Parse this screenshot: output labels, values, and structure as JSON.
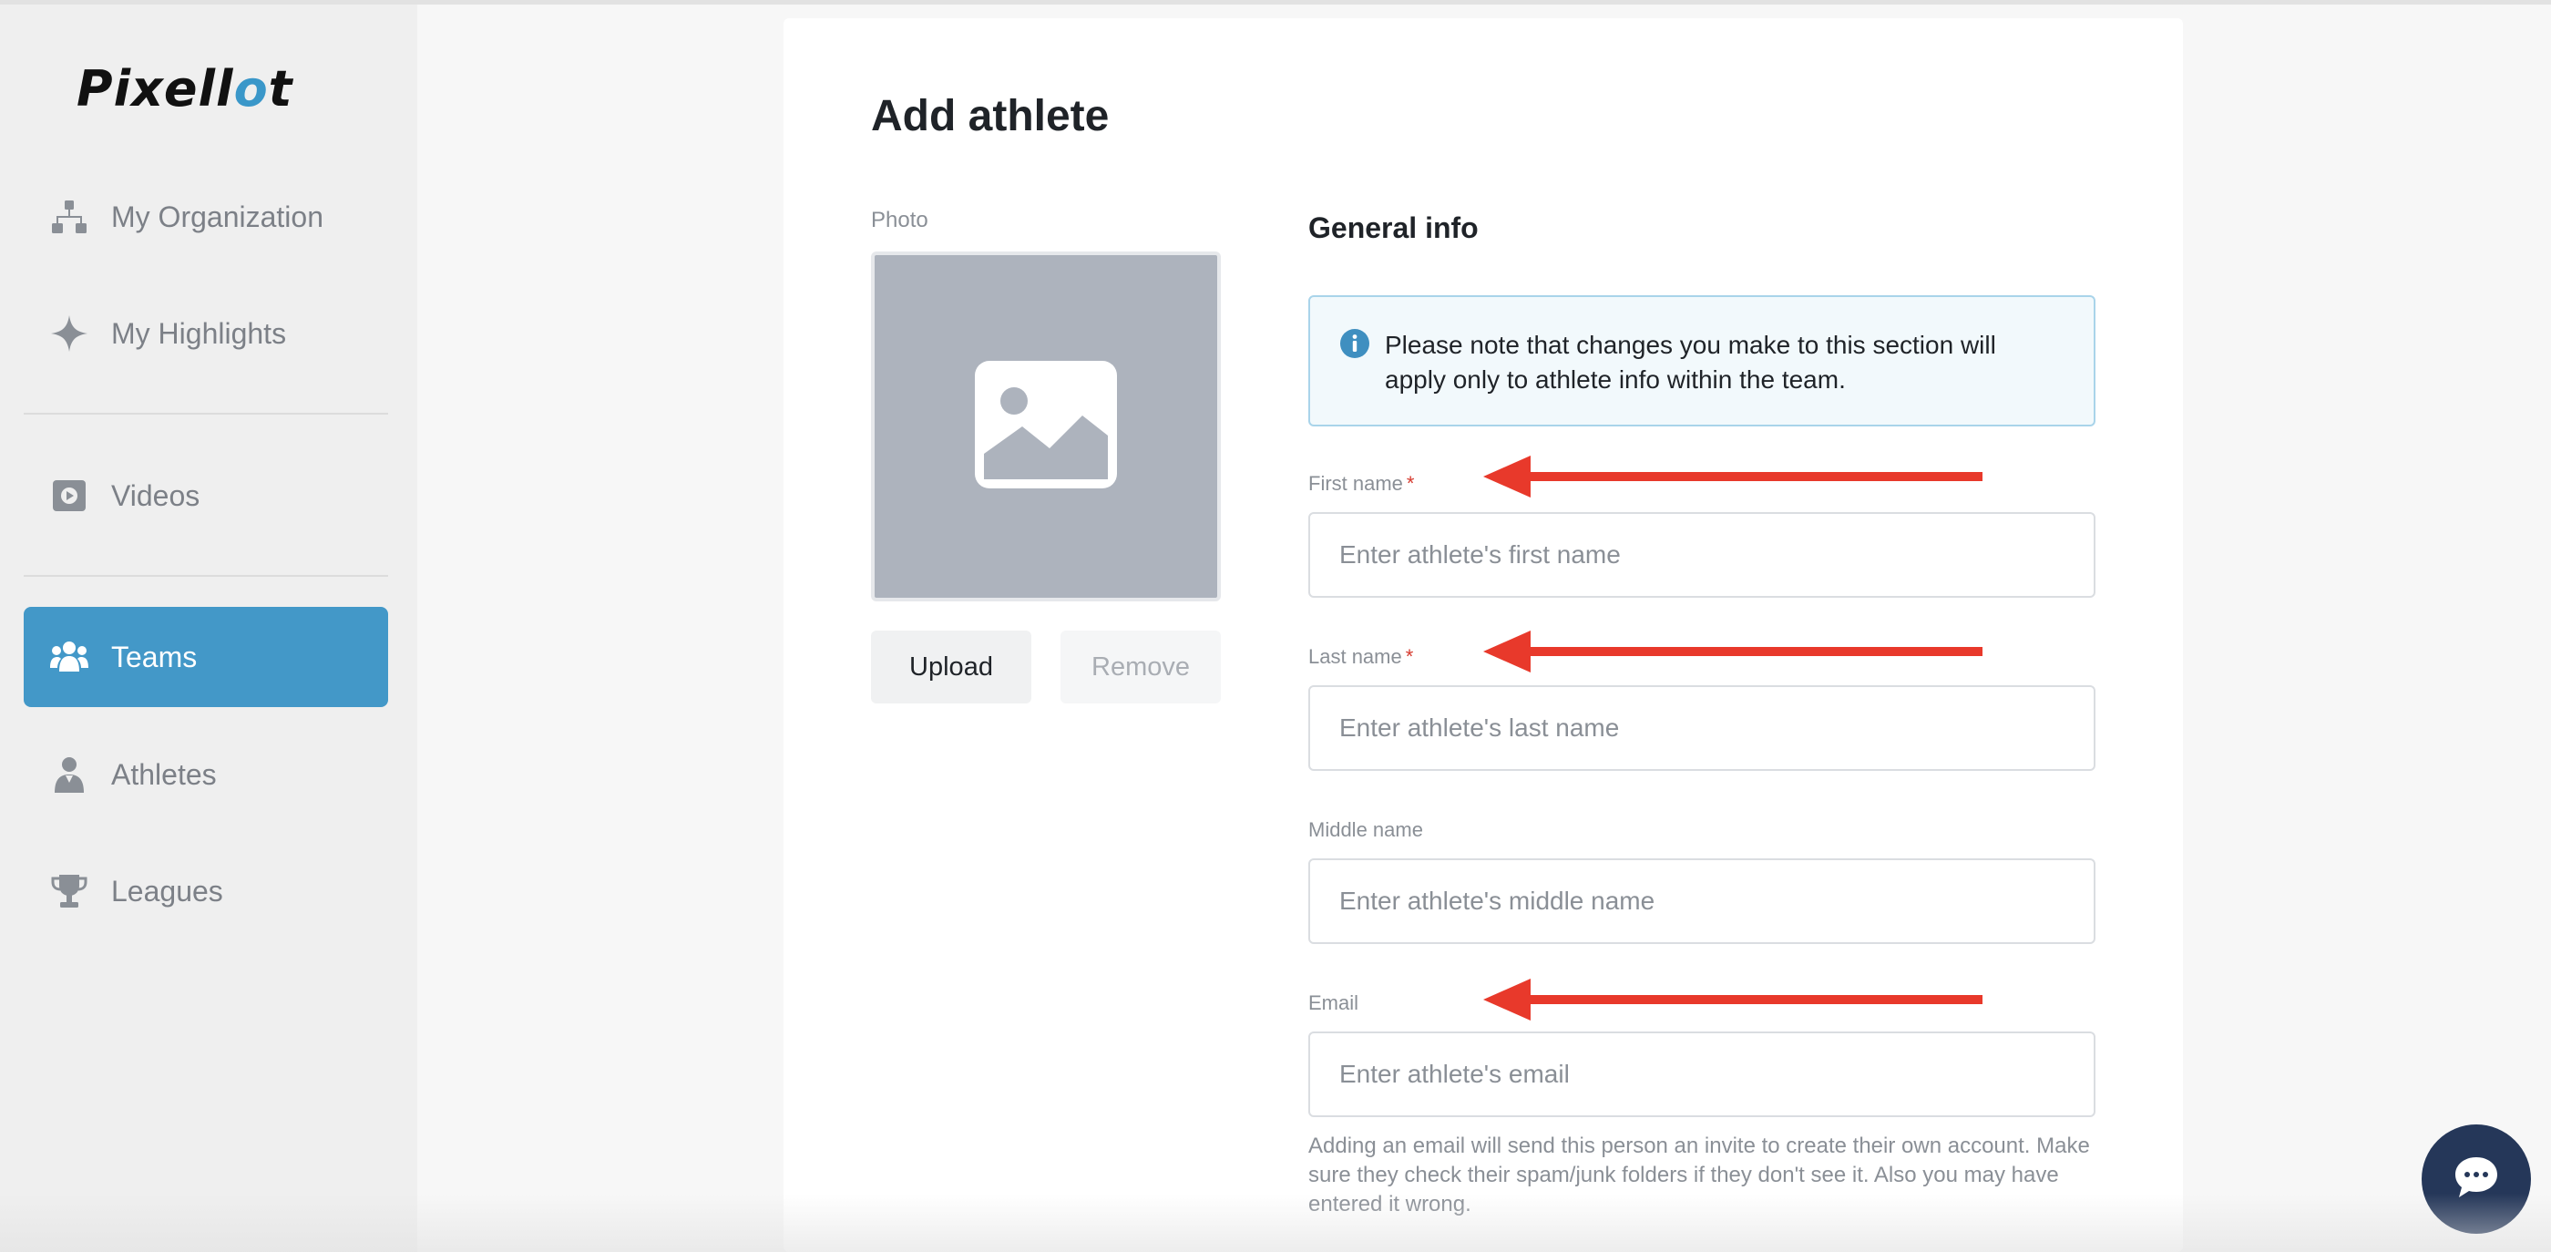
{
  "brand": {
    "logo_text_prefix": "Pixell",
    "logo_text_accent": "o",
    "logo_text_suffix": "t",
    "accent_color": "#3a97c9"
  },
  "sidebar": {
    "active_color": "#4398c8",
    "items": [
      {
        "label": "My Organization",
        "icon": "org-chart-icon"
      },
      {
        "label": "My Highlights",
        "icon": "sparkle-icon"
      },
      {
        "label": "Videos",
        "icon": "video-icon"
      },
      {
        "label": "Teams",
        "icon": "teams-icon",
        "active": true
      },
      {
        "label": "Athletes",
        "icon": "athlete-icon"
      },
      {
        "label": "Leagues",
        "icon": "trophy-icon"
      }
    ]
  },
  "page": {
    "title": "Add athlete",
    "photo_label": "Photo",
    "upload_label": "Upload",
    "remove_label": "Remove"
  },
  "general_info": {
    "title": "General info",
    "notice": "Please note that changes you make to this section will apply only to athlete info within the team.",
    "fields": {
      "first_name": {
        "label": "First name",
        "required_mark": "*",
        "placeholder": "Enter athlete's first name",
        "value": ""
      },
      "last_name": {
        "label": "Last name",
        "required_mark": "*",
        "placeholder": "Enter athlete's last name",
        "value": ""
      },
      "middle_name": {
        "label": "Middle name",
        "placeholder": "Enter athlete's middle name",
        "value": ""
      },
      "email": {
        "label": "Email",
        "placeholder": "Enter athlete's email",
        "value": ""
      }
    },
    "email_hint": "Adding an email will send this person an invite to create their own account. Make sure they check their spam/junk folders if they don't see it. Also you may have entered it wrong."
  },
  "annotations": {
    "arrow_color": "#e8392b"
  },
  "chat": {
    "icon": "chat-bubble-icon",
    "color": "#253759"
  }
}
